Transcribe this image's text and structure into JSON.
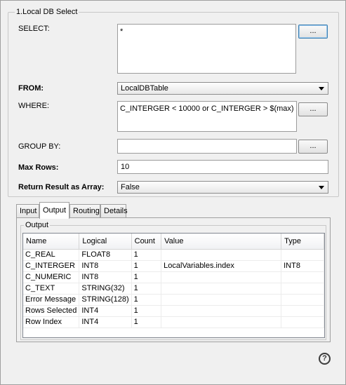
{
  "section": {
    "title": "1.Local DB Select"
  },
  "select": {
    "label": "SELECT:",
    "value": "*",
    "button": "..."
  },
  "from": {
    "label": "FROM:",
    "value": "LocalDBTable"
  },
  "where": {
    "label": "WHERE:",
    "value": "C_INTERGER < 10000 or C_INTERGER > $(max)",
    "button": "..."
  },
  "group_by": {
    "label": "GROUP BY:",
    "value": "",
    "button": "..."
  },
  "max_rows": {
    "label": "Max Rows:",
    "value": "10"
  },
  "return_array": {
    "label": "Return Result as Array:",
    "value": "False"
  },
  "tabs": [
    {
      "label": "Input"
    },
    {
      "label": "Output"
    },
    {
      "label": "Routing"
    },
    {
      "label": "Details"
    }
  ],
  "output": {
    "title": "Output",
    "columns": [
      "Name",
      "Logical",
      "Count",
      "Value",
      "Type"
    ],
    "rows": [
      [
        "C_REAL",
        "FLOAT8",
        "1",
        "",
        ""
      ],
      [
        "C_INTERGER",
        "INT8",
        "1",
        "LocalVariables.index",
        "INT8"
      ],
      [
        "C_NUMERIC",
        "INT8",
        "1",
        "",
        ""
      ],
      [
        "C_TEXT",
        "STRING(32)",
        "1",
        "",
        ""
      ],
      [
        "Error Message",
        "STRING(128)",
        "1",
        "",
        ""
      ],
      [
        "Rows Selected",
        "INT4",
        "1",
        "",
        ""
      ],
      [
        "Row Index",
        "INT4",
        "1",
        "",
        ""
      ]
    ]
  },
  "help_icon": "question-icon"
}
